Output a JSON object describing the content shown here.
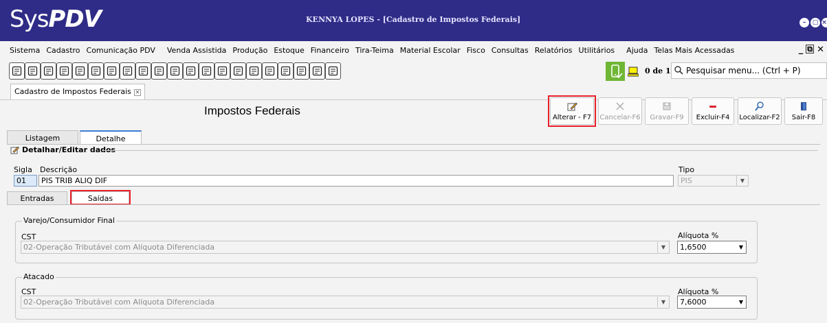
{
  "app": {
    "logo_light": "Sys",
    "logo_bold": "PDV",
    "window_title": "KENNYA LOPES - [Cadastro de Impostos Federais]"
  },
  "menu": [
    "Sistema",
    "Cadastro",
    "Comunicação PDV",
    "Venda Assistida",
    "Produção",
    "Estoque",
    "Financeiro",
    "Tira-Teima",
    "Material Escolar",
    "Fisco",
    "Consultas",
    "Relatórios",
    "Utilitários",
    "Ajuda",
    "Telas Mais Acessadas"
  ],
  "mdi_controls": [
    "_",
    "🗗",
    "✕"
  ],
  "toolbar": {
    "pager": "0 de 1",
    "search_placeholder": "Pesquisar menu... (Ctrl + P)"
  },
  "doc_tab": {
    "label": "Cadastro de Impostos Federais",
    "close": "✕"
  },
  "header": {
    "title": "Impostos Federais",
    "buttons": [
      {
        "label": "Alterar - F7",
        "icon": "edit-icon",
        "enabled": true,
        "highlighted": true
      },
      {
        "label": "Cancelar-F6",
        "icon": "close-icon",
        "enabled": false
      },
      {
        "label": "Gravar-F9",
        "icon": "save-icon",
        "enabled": false
      },
      {
        "label": "Excluir-F4",
        "icon": "minus-icon",
        "enabled": true
      },
      {
        "label": "Localizar-F2",
        "icon": "search-icon",
        "enabled": true
      },
      {
        "label": "Sair-F8",
        "icon": "exit-door-icon",
        "enabled": true
      }
    ]
  },
  "main_tabs": {
    "listagem": "Listagem",
    "detalhe": "Detalhe"
  },
  "section_title": "Detalhar/Editar dados",
  "form": {
    "sigla_label": "Sigla",
    "sigla_value": "01",
    "descricao_label": "Descrição",
    "descricao_value": "PIS TRIB ALIQ DIF",
    "tipo_label": "Tipo",
    "tipo_value": "PIS"
  },
  "sub_tabs": {
    "entradas": "Entradas",
    "saidas": "Saídas"
  },
  "groups": [
    {
      "title": "Varejo/Consumidor Final",
      "cst_label": "CST",
      "cst_value": "02-Operação Tributável com Alíquota Diferenciada",
      "aliq_label": "Alíquota %",
      "aliq_value": "1,6500"
    },
    {
      "title": "Atacado",
      "cst_label": "CST",
      "cst_value": "02-Operação Tributável com Alíquota Diferenciada",
      "aliq_label": "Alíquota %",
      "aliq_value": "7,6000"
    }
  ]
}
